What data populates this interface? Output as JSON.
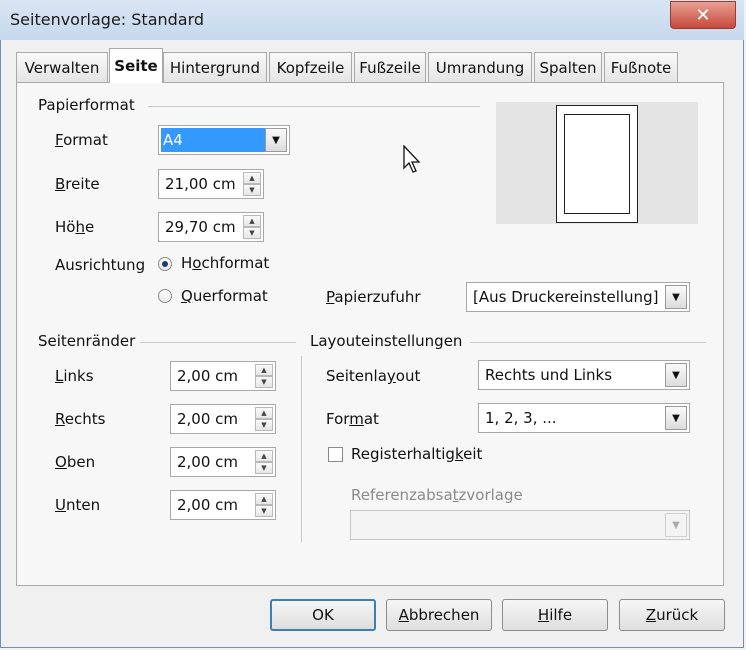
{
  "window": {
    "title": "Seitenvorlage: Standard",
    "close_symbol": "✕"
  },
  "tabs": [
    {
      "label": "Verwalten"
    },
    {
      "label": "Seite",
      "active": true
    },
    {
      "label": "Hintergrund"
    },
    {
      "label": "Kopfzeile"
    },
    {
      "label": "Fußzeile"
    },
    {
      "label": "Umrandung"
    },
    {
      "label": "Spalten"
    },
    {
      "label": "Fußnote"
    }
  ],
  "papierformat": {
    "title": "Papierformat",
    "format_label": "Format",
    "format_value": "A4",
    "breite_label": "Breite",
    "breite_value": "21,00 cm",
    "hoehe_label": "Höhe",
    "hoehe_value": "29,70 cm",
    "ausrichtung_label": "Ausrichtung",
    "hochformat_label": "Hochformat",
    "querformat_label": "Querformat",
    "papierzufuhr_label": "Papierzufuhr",
    "papierzufuhr_value": "[Aus Druckereinstellung]"
  },
  "seitenraender": {
    "title": "Seitenränder",
    "links_label": "Links",
    "links_value": "2,00 cm",
    "rechts_label": "Rechts",
    "rechts_value": "2,00 cm",
    "oben_label": "Oben",
    "oben_value": "2,00 cm",
    "unten_label": "Unten",
    "unten_value": "2,00 cm"
  },
  "layout": {
    "title": "Layouteinstellungen",
    "seitenlayout_label": "Seitenlayout",
    "seitenlayout_value": "Rechts und Links",
    "format_label": "Format",
    "format_value": "1, 2, 3, ...",
    "registerhaltigkeit_label": "Registerhaltigkeit",
    "referenz_label": "Referenzabsatzvorlage",
    "referenz_value": ""
  },
  "buttons": {
    "ok": "OK",
    "abbrechen": "Abbrechen",
    "hilfe": "Hilfe",
    "zurueck": "Zurück"
  },
  "colors": {
    "selection": "#3399ff",
    "title_bar": "#c6d8ee",
    "close": "#c6483a"
  }
}
